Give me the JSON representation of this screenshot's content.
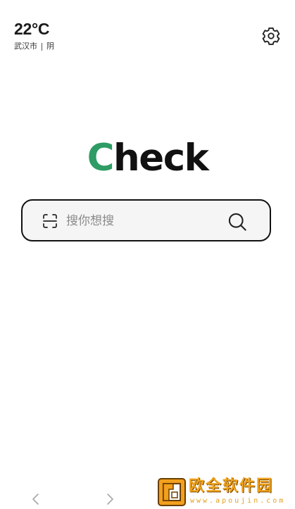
{
  "weather": {
    "temperature": "22°C",
    "city": "武汉市",
    "condition": "阴"
  },
  "logo": {
    "first_letter": "C",
    "rest": "heck",
    "accent_color": "#2e9c64"
  },
  "search": {
    "placeholder": "搜你想搜",
    "value": ""
  },
  "icons": {
    "settings": "gear-icon",
    "scan": "scan-icon",
    "search": "search-icon",
    "back": "chevron-left-icon",
    "forward": "chevron-right-icon"
  },
  "watermark": {
    "title": "欧全软件园",
    "url": "www.apoujin.com"
  }
}
